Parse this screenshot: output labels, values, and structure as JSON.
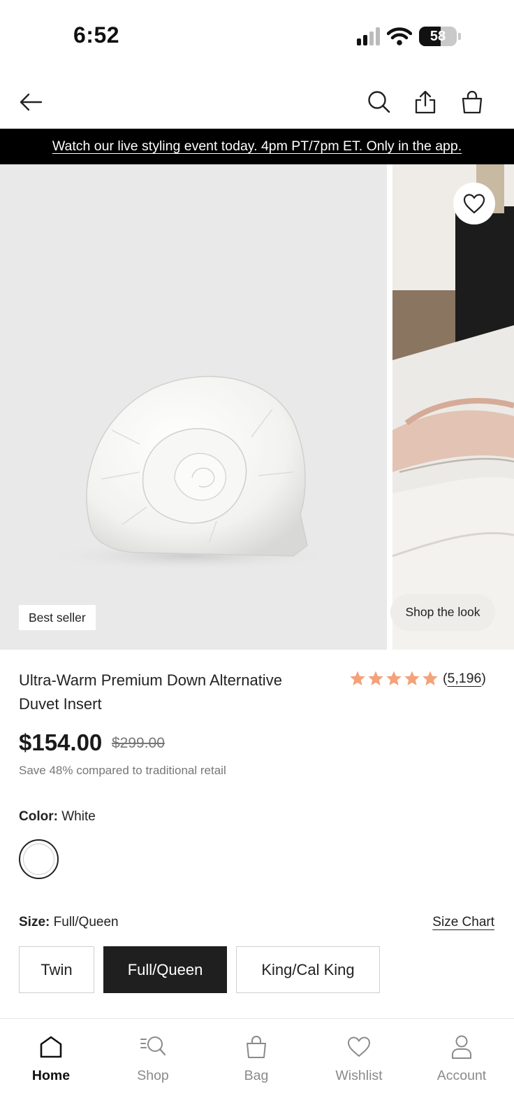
{
  "status_bar": {
    "time": "6:52",
    "battery": "58"
  },
  "promo": {
    "text": "Watch our live styling event today. 4pm PT/7pm ET. Only in the app."
  },
  "gallery": {
    "badge": "Best seller",
    "shop_the_look": "Shop the look"
  },
  "product": {
    "title": "Ultra-Warm Premium Down Alternative Duvet Insert",
    "rating": 5,
    "review_count": "5,196",
    "price": "$154.00",
    "original_price": "$299.00",
    "savings": "Save 48% compared to traditional retail",
    "star_color": "#f4a27a"
  },
  "color": {
    "label": "Color:",
    "value": "White"
  },
  "size": {
    "label": "Size:",
    "value": "Full/Queen",
    "chart_label": "Size Chart",
    "options": [
      {
        "label": "Twin",
        "selected": false
      },
      {
        "label": "Full/Queen",
        "selected": true
      },
      {
        "label": "King/Cal King",
        "selected": false
      }
    ]
  },
  "tabs": [
    {
      "label": "Home",
      "icon": "home-icon",
      "active": true
    },
    {
      "label": "Shop",
      "icon": "shop-search-icon",
      "active": false
    },
    {
      "label": "Bag",
      "icon": "bag-icon",
      "active": false
    },
    {
      "label": "Wishlist",
      "icon": "heart-icon",
      "active": false
    },
    {
      "label": "Account",
      "icon": "person-icon",
      "active": false
    }
  ]
}
